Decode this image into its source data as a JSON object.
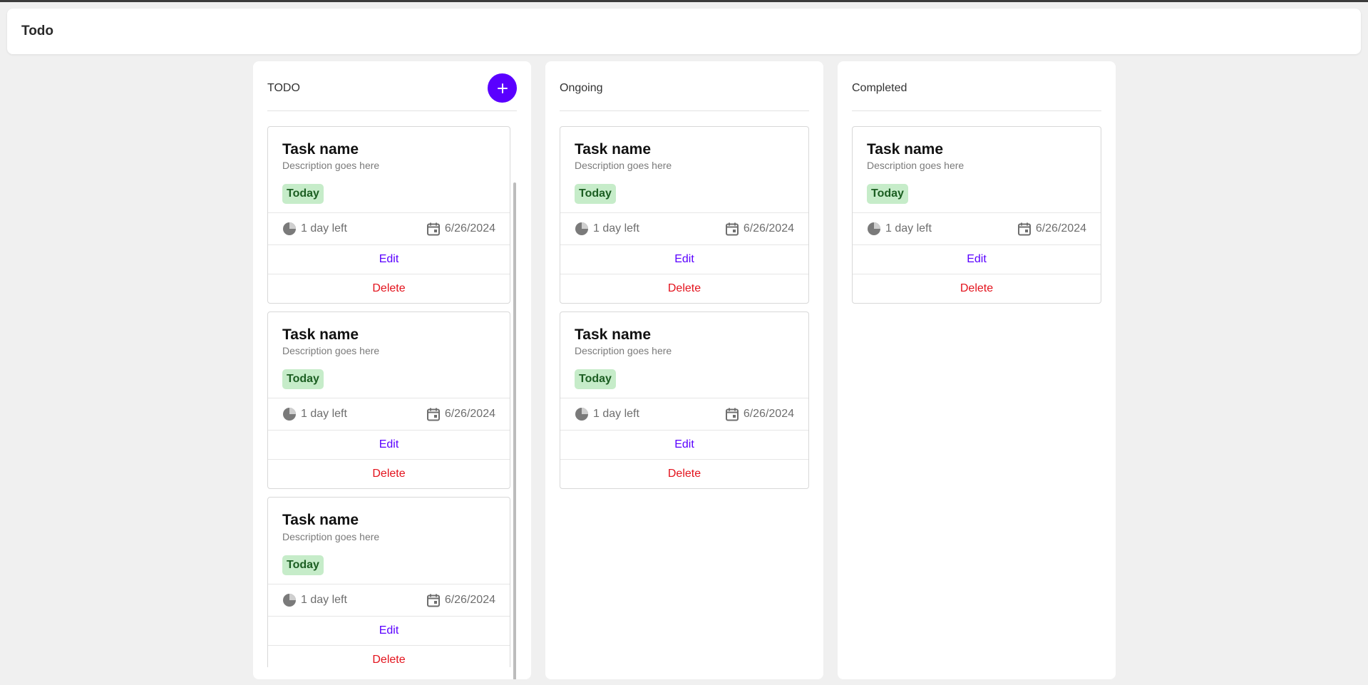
{
  "header": {
    "title": "Todo"
  },
  "colors": {
    "accent": "#5a00ff",
    "danger": "#e3121c",
    "badge_bg": "#c6ecc9",
    "badge_text": "#1c5e22"
  },
  "columns": [
    {
      "title": "TODO",
      "cards": [
        {
          "name": "Task name",
          "description": "Description goes here",
          "badge": "Today",
          "time_left": "1 day left",
          "date": "6/26/2024",
          "edit": "Edit",
          "delete": "Delete"
        },
        {
          "name": "Task name",
          "description": "Description goes here",
          "badge": "Today",
          "time_left": "1 day left",
          "date": "6/26/2024",
          "edit": "Edit",
          "delete": "Delete"
        },
        {
          "name": "Task name",
          "description": "Description goes here",
          "badge": "Today",
          "time_left": "1 day left",
          "date": "6/26/2024",
          "edit": "Edit",
          "delete": "Delete"
        }
      ]
    },
    {
      "title": "Ongoing",
      "cards": [
        {
          "name": "Task name",
          "description": "Description goes here",
          "badge": "Today",
          "time_left": "1 day left",
          "date": "6/26/2024",
          "edit": "Edit",
          "delete": "Delete"
        },
        {
          "name": "Task name",
          "description": "Description goes here",
          "badge": "Today",
          "time_left": "1 day left",
          "date": "6/26/2024",
          "edit": "Edit",
          "delete": "Delete"
        }
      ]
    },
    {
      "title": "Completed",
      "cards": [
        {
          "name": "Task name",
          "description": "Description goes here",
          "badge": "Today",
          "time_left": "1 day left",
          "date": "6/26/2024",
          "edit": "Edit",
          "delete": "Delete"
        }
      ]
    }
  ]
}
